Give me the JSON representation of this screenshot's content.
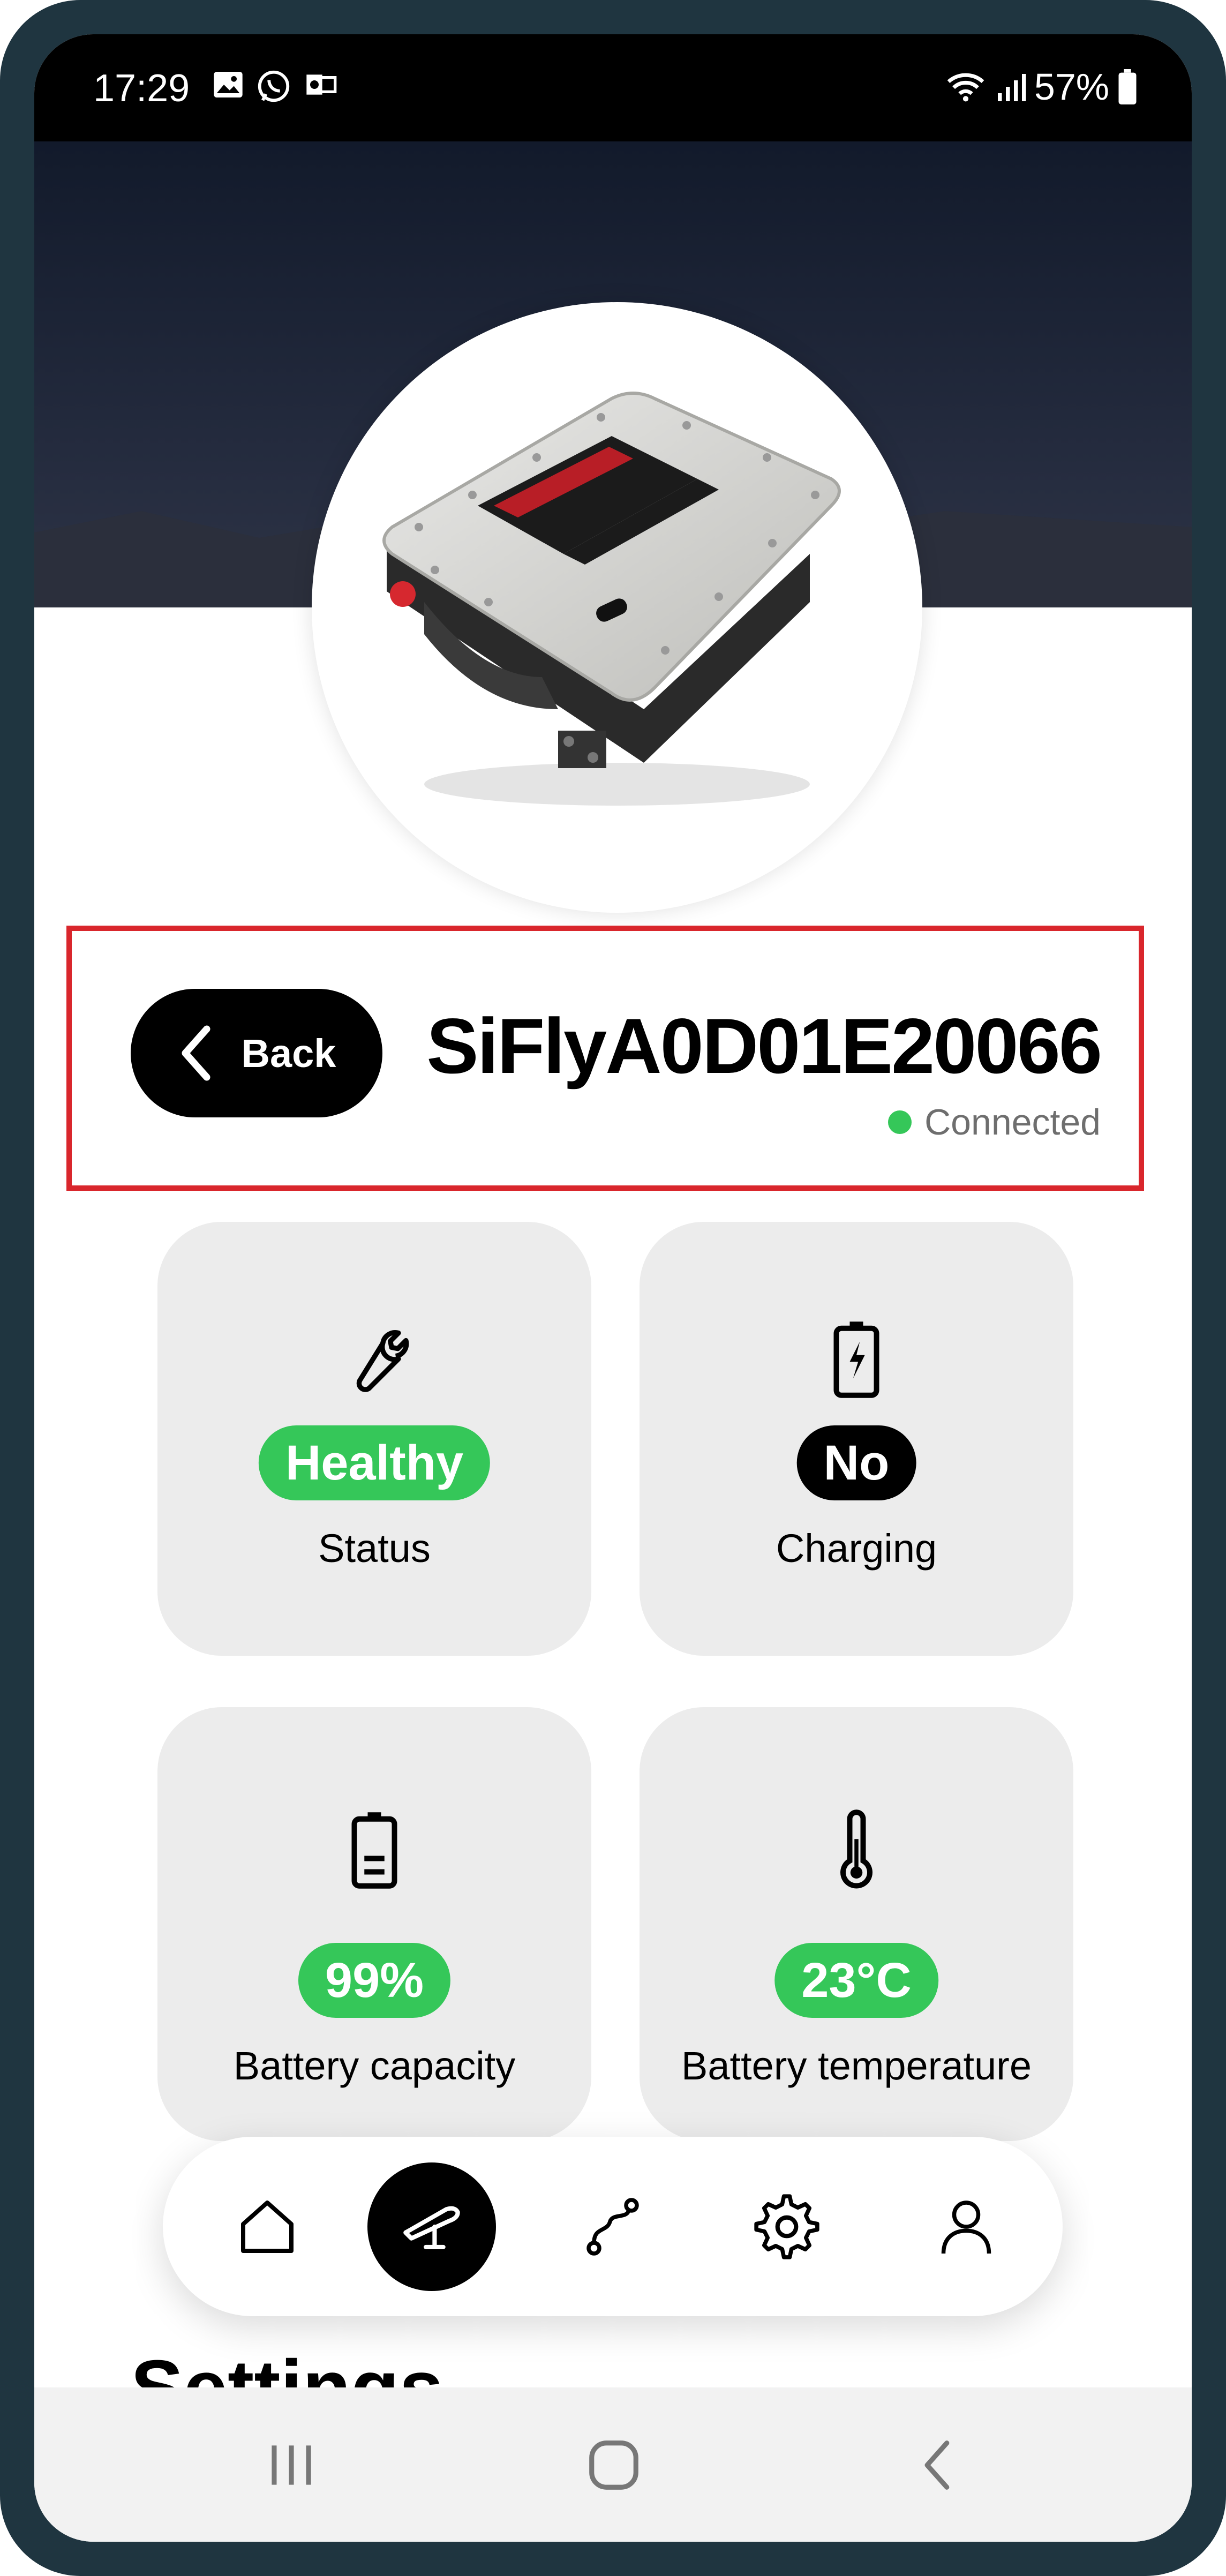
{
  "status_bar": {
    "time": "17:29",
    "battery_percent": "57%"
  },
  "device": {
    "name": "SiFlyA0D01E20066",
    "connection_status": "Connected"
  },
  "back_button": {
    "label": "Back"
  },
  "cards": [
    {
      "icon": "wrench-icon",
      "value": "Healthy",
      "label": "Status",
      "value_color": "#35c759"
    },
    {
      "icon": "charging-battery-icon",
      "value": "No",
      "label": "Charging",
      "value_color": "#000000"
    },
    {
      "icon": "battery-icon",
      "value": "99%",
      "label": "Battery capacity",
      "value_color": "#35c759"
    },
    {
      "icon": "thermometer-icon",
      "value": "23°C",
      "label": "Battery temperature",
      "value_color": "#35c759"
    }
  ],
  "settings_title": "Settings",
  "nav": {
    "items": [
      "home-icon",
      "device-icon",
      "route-icon",
      "settings-icon",
      "profile-icon"
    ],
    "active": "device-icon"
  },
  "colors": {
    "accent_green": "#35c759",
    "highlight_red": "#d9262c",
    "frame": "#1f3540"
  }
}
